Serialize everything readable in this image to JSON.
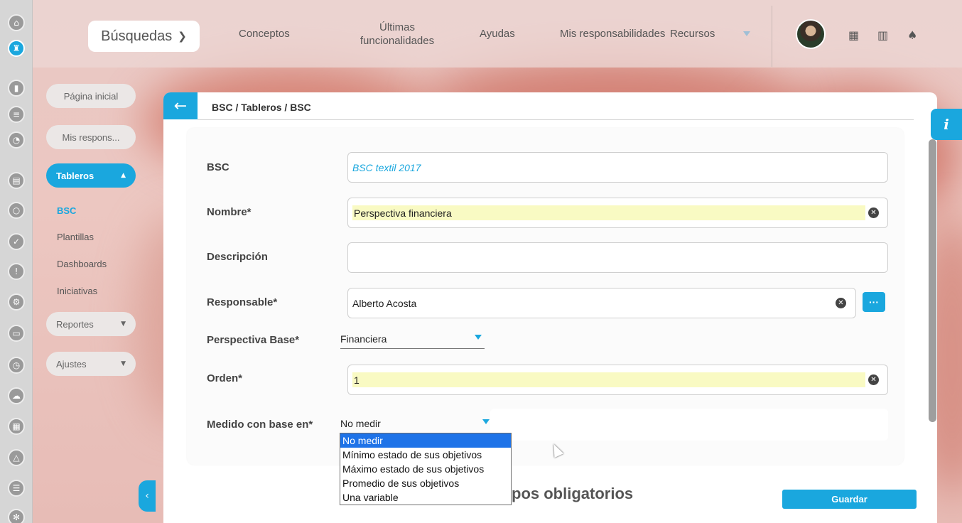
{
  "topbar": {
    "search_label": "Búsquedas",
    "nav": [
      "Conceptos",
      "Últimas funcionalidades",
      "Ayudas",
      "Mis responsabilidades",
      "Recursos"
    ]
  },
  "sidebar": {
    "pills": {
      "home": "Página inicial",
      "mis_respons": "Mis respons...",
      "tableros": "Tableros",
      "reportes": "Reportes",
      "ajustes": "Ajustes"
    },
    "sub_items": [
      "BSC",
      "Plantillas",
      "Dashboards",
      "Iniciativas"
    ]
  },
  "breadcrumb": "BSC / Tableros / BSC",
  "form": {
    "bsc_label": "BSC",
    "bsc_value": "BSC textil 2017",
    "nombre_label": "Nombre*",
    "nombre_value": "Perspectiva financiera",
    "descripcion_label": "Descripción",
    "descripcion_value": "",
    "responsable_label": "Responsable*",
    "responsable_value": "Alberto Acosta",
    "responsable_btn": "···",
    "perspectiva_label": "Perspectiva Base*",
    "perspectiva_value": "Financiera",
    "orden_label": "Orden*",
    "orden_value": "1",
    "medido_label": "Medido con base en*",
    "medido_value": "No medir",
    "medido_options": [
      "No medir",
      "Mínimo estado de sus objetivos",
      "Máximo estado de sus objetivos",
      "Promedio de sus objetivos",
      "Una variable"
    ]
  },
  "footer": {
    "required_text": "pos obligatorios",
    "save_label": "Guardar"
  },
  "info_label": "i",
  "colors": {
    "accent": "#1aa7de",
    "highlight": "#f9fac3",
    "dropdown_selected": "#1e73e8"
  },
  "icons": {
    "rail": [
      "home-icon",
      "rook-icon",
      "bar-chart-icon",
      "align-icon",
      "pie-chart-icon",
      "document-icon",
      "circle-icon",
      "check-icon",
      "warning-icon",
      "process-icon",
      "presentation-icon",
      "clock-icon",
      "cloud-icon",
      "calendar-icon",
      "network-icon",
      "list-icon",
      "gear-icon"
    ],
    "top": [
      "calendar-icon",
      "book-icon",
      "bell-icon"
    ]
  }
}
